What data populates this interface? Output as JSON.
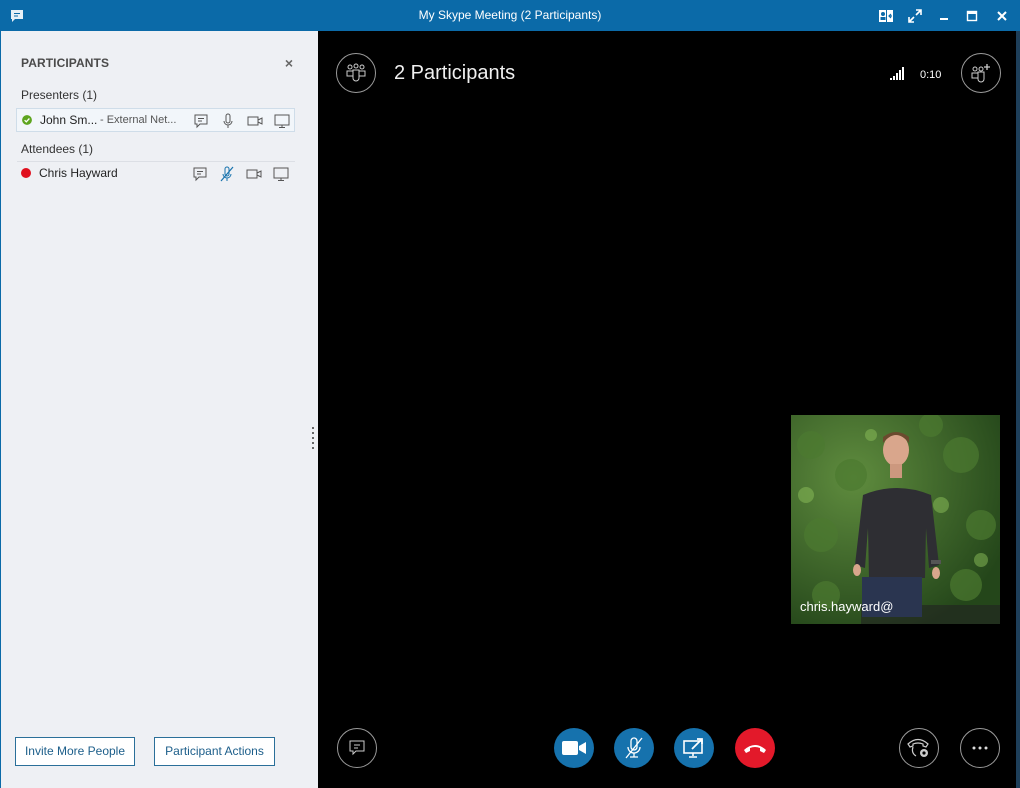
{
  "window": {
    "title": "My Skype Meeting (2 Participants)",
    "controls": [
      "contact-card",
      "full-screen",
      "minimize",
      "maximize",
      "close"
    ]
  },
  "sidebar": {
    "title": "PARTICIPANTS",
    "close_label": "×",
    "groups": [
      {
        "label": "Presenters (1)",
        "participants": [
          {
            "name": "John Sm...",
            "note": "- External Net...",
            "status": "available",
            "status_color": "#5ea51f",
            "muted": false,
            "selected": true
          }
        ]
      },
      {
        "label": "Attendees (1)",
        "participants": [
          {
            "name": "Chris Hayward",
            "note": "",
            "status": "busy",
            "status_color": "#e0101e",
            "muted": true,
            "selected": false
          }
        ]
      }
    ],
    "row_actions": [
      "IM",
      "Audio",
      "Video",
      "Share screen"
    ],
    "buttons": {
      "invite": "Invite More People",
      "invite_mnemonic": "v",
      "actions": "Participant Actions",
      "actions_mnemonic": "P"
    }
  },
  "stage": {
    "participants_count_label": "2 Participants",
    "timer": "0:10",
    "self_view_caption": "chris.hayward@",
    "controls": {
      "video": "Video",
      "mic": "Mute (muted)",
      "share": "Present",
      "hangup": "Hang up",
      "chat": "IM",
      "call_controls": "Call controls",
      "more": "More options"
    }
  },
  "colors": {
    "titlebar": "#0b6aa8",
    "sidebar_bg": "#eef0f4",
    "accent_blue": "#1672ad",
    "hangup_red": "#e3192a"
  }
}
